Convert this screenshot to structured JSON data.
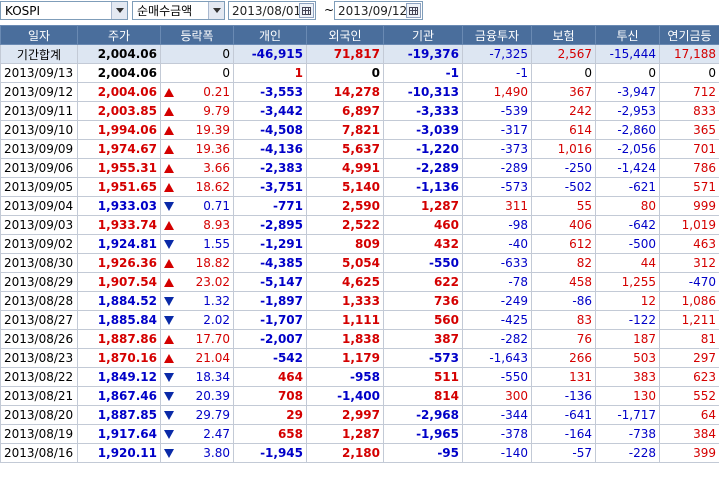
{
  "toolbar": {
    "market": "KOSPI",
    "mode": "순매수금액",
    "date_from": "2013/08/01",
    "date_to": "2013/09/12",
    "separator": "~"
  },
  "columns": [
    "일자",
    "주가",
    "등락폭",
    "개인",
    "외국인",
    "기관",
    "금융투자",
    "보험",
    "투신",
    "연기금등"
  ],
  "total": {
    "label": "기간합계",
    "price": "2,004.06",
    "change": "0",
    "values": [
      "-46,915",
      "71,817",
      "-19,376",
      "-7,325",
      "2,567",
      "-15,444",
      "17,188"
    ]
  },
  "rows": [
    {
      "date": "2013/09/13",
      "price": "2,004.06",
      "dir": "none",
      "change": "0",
      "values": [
        "1",
        "0",
        "-1",
        "-1",
        "0",
        "0",
        "0"
      ]
    },
    {
      "date": "2013/09/12",
      "price": "2,004.06",
      "dir": "up",
      "change": "0.21",
      "values": [
        "-3,553",
        "14,278",
        "-10,313",
        "1,490",
        "367",
        "-3,947",
        "712"
      ]
    },
    {
      "date": "2013/09/11",
      "price": "2,003.85",
      "dir": "up",
      "change": "9.79",
      "values": [
        "-3,442",
        "6,897",
        "-3,333",
        "-539",
        "242",
        "-2,953",
        "833"
      ]
    },
    {
      "date": "2013/09/10",
      "price": "1,994.06",
      "dir": "up",
      "change": "19.39",
      "values": [
        "-4,508",
        "7,821",
        "-3,039",
        "-317",
        "614",
        "-2,860",
        "365"
      ]
    },
    {
      "date": "2013/09/09",
      "price": "1,974.67",
      "dir": "up",
      "change": "19.36",
      "values": [
        "-4,136",
        "5,637",
        "-1,220",
        "-373",
        "1,016",
        "-2,056",
        "701"
      ]
    },
    {
      "date": "2013/09/06",
      "price": "1,955.31",
      "dir": "up",
      "change": "3.66",
      "values": [
        "-2,383",
        "4,991",
        "-2,289",
        "-289",
        "-250",
        "-1,424",
        "786"
      ]
    },
    {
      "date": "2013/09/05",
      "price": "1,951.65",
      "dir": "up",
      "change": "18.62",
      "values": [
        "-3,751",
        "5,140",
        "-1,136",
        "-573",
        "-502",
        "-621",
        "571"
      ]
    },
    {
      "date": "2013/09/04",
      "price": "1,933.03",
      "dir": "dn",
      "change": "0.71",
      "values": [
        "-771",
        "2,590",
        "1,287",
        "311",
        "55",
        "80",
        "999"
      ]
    },
    {
      "date": "2013/09/03",
      "price": "1,933.74",
      "dir": "up",
      "change": "8.93",
      "values": [
        "-2,895",
        "2,522",
        "460",
        "-98",
        "406",
        "-642",
        "1,019"
      ]
    },
    {
      "date": "2013/09/02",
      "price": "1,924.81",
      "dir": "dn",
      "change": "1.55",
      "values": [
        "-1,291",
        "809",
        "432",
        "-40",
        "612",
        "-500",
        "463"
      ]
    },
    {
      "date": "2013/08/30",
      "price": "1,926.36",
      "dir": "up",
      "change": "18.82",
      "values": [
        "-4,385",
        "5,054",
        "-550",
        "-633",
        "82",
        "44",
        "312"
      ]
    },
    {
      "date": "2013/08/29",
      "price": "1,907.54",
      "dir": "up",
      "change": "23.02",
      "values": [
        "-5,147",
        "4,625",
        "622",
        "-78",
        "458",
        "1,255",
        "-470"
      ]
    },
    {
      "date": "2013/08/28",
      "price": "1,884.52",
      "dir": "dn",
      "change": "1.32",
      "values": [
        "-1,897",
        "1,333",
        "736",
        "-249",
        "-86",
        "12",
        "1,086"
      ]
    },
    {
      "date": "2013/08/27",
      "price": "1,885.84",
      "dir": "dn",
      "change": "2.02",
      "values": [
        "-1,707",
        "1,111",
        "560",
        "-425",
        "83",
        "-122",
        "1,211"
      ]
    },
    {
      "date": "2013/08/26",
      "price": "1,887.86",
      "dir": "up",
      "change": "17.70",
      "values": [
        "-2,007",
        "1,838",
        "387",
        "-282",
        "76",
        "187",
        "81"
      ]
    },
    {
      "date": "2013/08/23",
      "price": "1,870.16",
      "dir": "up",
      "change": "21.04",
      "values": [
        "-542",
        "1,179",
        "-573",
        "-1,643",
        "266",
        "503",
        "297"
      ]
    },
    {
      "date": "2013/08/22",
      "price": "1,849.12",
      "dir": "dn",
      "change": "18.34",
      "values": [
        "464",
        "-958",
        "511",
        "-550",
        "131",
        "383",
        "623"
      ]
    },
    {
      "date": "2013/08/21",
      "price": "1,867.46",
      "dir": "dn",
      "change": "20.39",
      "values": [
        "708",
        "-1,400",
        "814",
        "300",
        "-136",
        "130",
        "552"
      ]
    },
    {
      "date": "2013/08/20",
      "price": "1,887.85",
      "dir": "dn",
      "change": "29.79",
      "values": [
        "29",
        "2,997",
        "-2,968",
        "-344",
        "-641",
        "-1,717",
        "64"
      ]
    },
    {
      "date": "2013/08/19",
      "price": "1,917.64",
      "dir": "dn",
      "change": "2.47",
      "values": [
        "658",
        "1,287",
        "-1,965",
        "-378",
        "-164",
        "-738",
        "384"
      ]
    },
    {
      "date": "2013/08/16",
      "price": "1,920.11",
      "dir": "dn",
      "change": "3.80",
      "values": [
        "-1,945",
        "2,180",
        "-95",
        "-140",
        "-57",
        "-228",
        "399"
      ]
    }
  ],
  "colors": {
    "up": "#d40000",
    "down": "#0000c8",
    "header": "#4a6e9c",
    "total_row": "#dde6f2"
  }
}
